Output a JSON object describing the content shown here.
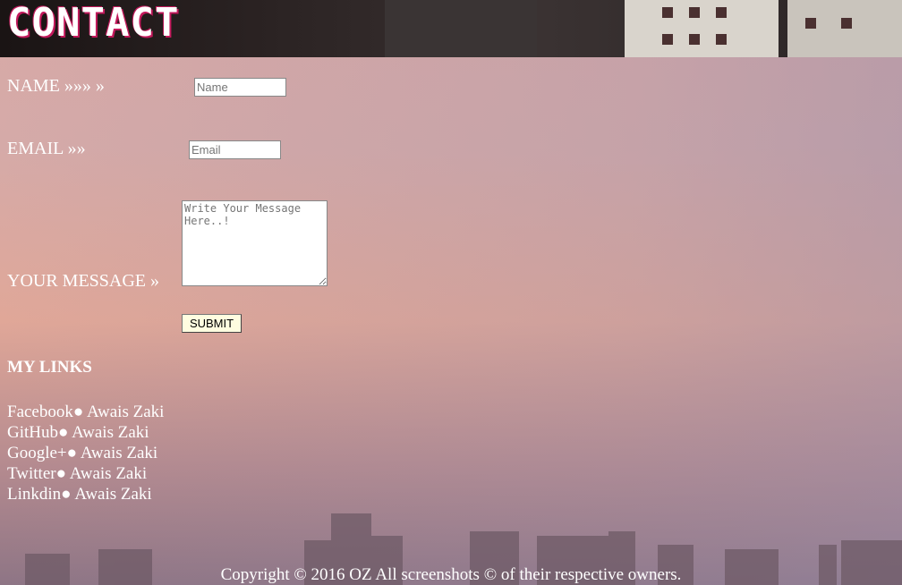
{
  "header": {
    "title": "CONTACT"
  },
  "form": {
    "name_label": "NAME  »»» »",
    "name_placeholder": "Name",
    "email_label": "EMAIL »»",
    "email_placeholder": "Email",
    "message_label": "YOUR MESSAGE  »",
    "message_placeholder": "Write Your Message Here..!",
    "submit_label": "SUBMIT"
  },
  "links": {
    "title": "MY LINKS",
    "items": [
      {
        "label": "Facebook● Awais Zaki"
      },
      {
        "label": "GitHub● Awais Zaki"
      },
      {
        "label": "Google+● Awais Zaki"
      },
      {
        "label": "Twitter● Awais Zaki"
      },
      {
        "label": "Linkdin● Awais Zaki"
      }
    ]
  },
  "footer": {
    "copyright": "Copyright © 2016 OZ All screenshots © of their respective owners."
  }
}
